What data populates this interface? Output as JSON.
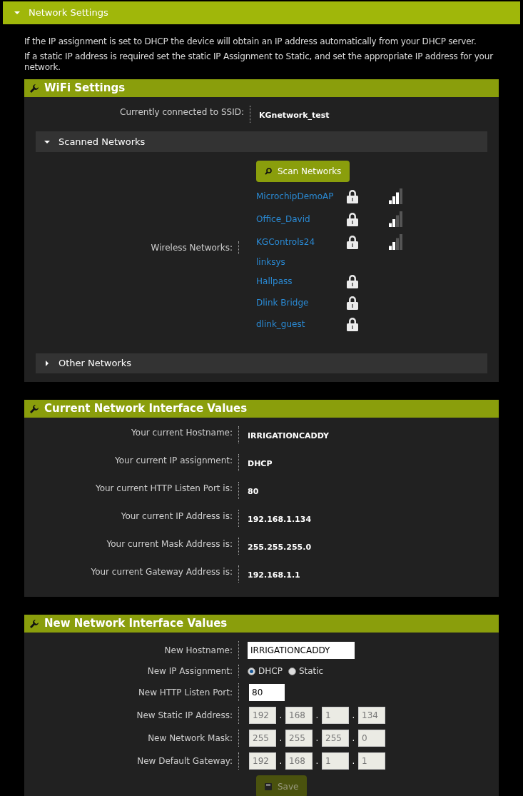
{
  "top_section": {
    "title": "Network Settings",
    "expanded": true
  },
  "intro": [
    "If the IP assignment is set to DHCP the device will obtain an IP address automatically from your DHCP server.",
    "If a static IP address is required set the static IP Assignment to Static, and set the appropriate IP address for your network."
  ],
  "wifi": {
    "title": "WiFi Settings",
    "ssid_label": "Currently connected to SSID:",
    "ssid": "KGnetwork_test",
    "scanned": {
      "title": "Scanned Networks",
      "expanded": true
    },
    "scan_button": "Scan Networks",
    "networks_label": "Wireless Networks:",
    "networks": [
      {
        "name": "MicrochipDemoAP",
        "locked": true,
        "kind": "strong"
      },
      {
        "name": "Office_David",
        "locked": true,
        "kind": "medium"
      },
      {
        "name": "KGControls24",
        "locked": true,
        "kind": "medium"
      },
      {
        "name": "linksys",
        "locked": false,
        "kind": "plain"
      },
      {
        "name": "Hallpass",
        "locked": true,
        "kind": "plain"
      },
      {
        "name": "Dlink Bridge",
        "locked": true,
        "kind": "plain"
      },
      {
        "name": "dlink_guest",
        "locked": true,
        "kind": "plain"
      }
    ],
    "other": {
      "title": "Other Networks",
      "expanded": false
    }
  },
  "current": {
    "title": "Current Network Interface Values",
    "rows": [
      {
        "label": "Your current Hostname:",
        "value": "IRRIGATIONCADDY"
      },
      {
        "label": "Your current IP assignment:",
        "value": "DHCP"
      },
      {
        "label": "Your current HTTP Listen Port is:",
        "value": "80"
      },
      {
        "label": "Your current IP Address is:",
        "value": "192.168.1.134"
      },
      {
        "label": "Your current Mask Address is:",
        "value": "255.255.255.0"
      },
      {
        "label": "Your current Gateway Address is:",
        "value": "192.168.1.1"
      }
    ]
  },
  "new": {
    "title": "New Network Interface Values",
    "octet_separator": ".",
    "rows": [
      {
        "kind": "text",
        "label": "New Hostname:",
        "value": "IRRIGATIONCADDY",
        "wide": true
      },
      {
        "kind": "radio",
        "label": "New IP Assignment:",
        "options": [
          {
            "label": "DHCP",
            "selected": true
          },
          {
            "label": "Static",
            "selected": false
          }
        ]
      },
      {
        "kind": "text",
        "label": "New HTTP Listen Port:",
        "value": "80",
        "wide": false
      },
      {
        "kind": "ip",
        "label": "New Static IP Address:",
        "octets": [
          "192",
          "168",
          "1",
          "134"
        ],
        "disabled": true
      },
      {
        "kind": "ip",
        "label": "New Network Mask:",
        "octets": [
          "255",
          "255",
          "255",
          "0"
        ],
        "disabled": true
      },
      {
        "kind": "ip",
        "label": "New Default Gateway:",
        "octets": [
          "192",
          "168",
          "1",
          "1"
        ],
        "disabled": true
      }
    ],
    "save": {
      "label": "Save",
      "disabled": true
    }
  }
}
